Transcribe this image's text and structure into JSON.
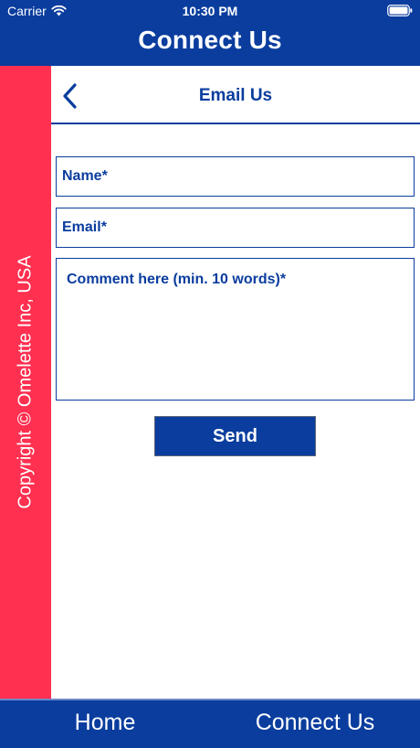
{
  "status_bar": {
    "carrier": "Carrier",
    "time": "10:30 PM",
    "wifi_icon": "wifi-icon",
    "battery_icon": "battery-icon"
  },
  "app_header": {
    "title": "Connect Us"
  },
  "sidebar": {
    "copyright": "Copyright © Omelette Inc, USA"
  },
  "nav": {
    "back_icon": "chevron-left-icon",
    "title": "Email Us"
  },
  "form": {
    "name_placeholder": "Name*",
    "name_value": "",
    "email_placeholder": "Email*",
    "email_value": "",
    "comment_placeholder": "Comment here (min. 10 words)*",
    "comment_value": "",
    "send_label": "Send"
  },
  "tab_bar": {
    "tabs": [
      {
        "label": "Home"
      },
      {
        "label": "Connect Us"
      }
    ]
  },
  "colors": {
    "primary_blue": "#0a3d9e",
    "sidebar_red": "#ff3050",
    "background": "#ffffff"
  }
}
